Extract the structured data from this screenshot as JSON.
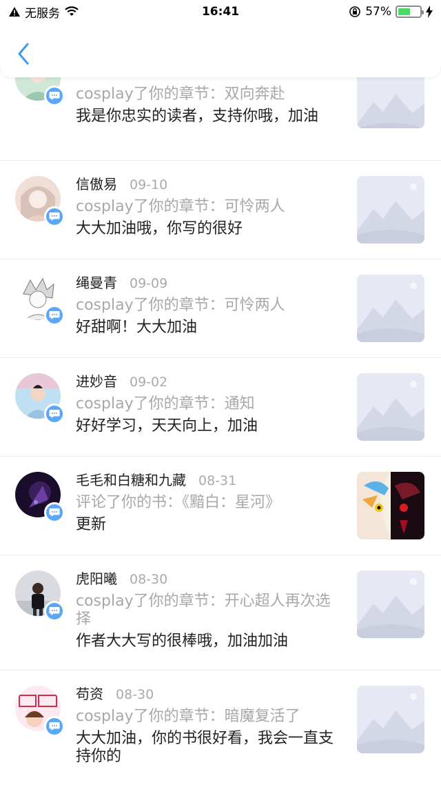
{
  "status_bar": {
    "carrier": "无服务",
    "time": "16:41",
    "battery_pct": "57%",
    "battery_level": 0.57,
    "icons": [
      "warning-icon",
      "wifi-icon",
      "orientation-lock-icon",
      "battery-icon",
      "charging-icon"
    ]
  },
  "header": {
    "back_icon": "chevron-left-icon",
    "accent": "#3b9cf0"
  },
  "items": [
    {
      "name": "",
      "date": "",
      "action": "cosplay了你的章节：双向奔赴",
      "comment": "我是你忠实的读者，支持你哦，加油",
      "thumb": "placeholder"
    },
    {
      "name": "信傲易",
      "date": "09-10",
      "action": "cosplay了你的章节：可怜两人",
      "comment": "大大加油哦，你写的很好",
      "thumb": "placeholder"
    },
    {
      "name": "绳曼青",
      "date": "09-09",
      "action": "cosplay了你的章节：可怜两人",
      "comment": "好甜啊！大大加油",
      "thumb": "placeholder"
    },
    {
      "name": "进妙音",
      "date": "09-02",
      "action": "cosplay了你的章节：通知",
      "comment": "好好学习，天天向上，加油",
      "thumb": "placeholder"
    },
    {
      "name": "毛毛和白糖和九藏",
      "date": "08-31",
      "action": "评论了你的书：《黯白：星河》",
      "comment": "更新",
      "thumb": "book-cover"
    },
    {
      "name": "虎阳曦",
      "date": "08-30",
      "action": "cosplay了你的章节：开心超人再次选择",
      "comment": "作者大大写的很棒哦，加油加油",
      "thumb": "placeholder"
    },
    {
      "name": "苟资",
      "date": "08-30",
      "action": "cosplay了你的章节：暗魔复活了",
      "comment": "大大加油，你的书很好看，我会一直支持你的",
      "thumb": "placeholder"
    }
  ]
}
